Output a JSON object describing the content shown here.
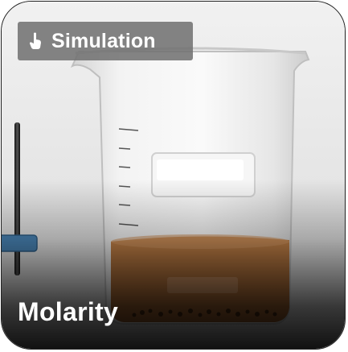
{
  "tag": {
    "icon": "pointer-hand-icon",
    "label": "Simulation"
  },
  "title": "Molarity",
  "colors": {
    "solution": "#b8743c",
    "slider_handle": "#4a86b8",
    "tag_background": "#6e6e6e"
  }
}
